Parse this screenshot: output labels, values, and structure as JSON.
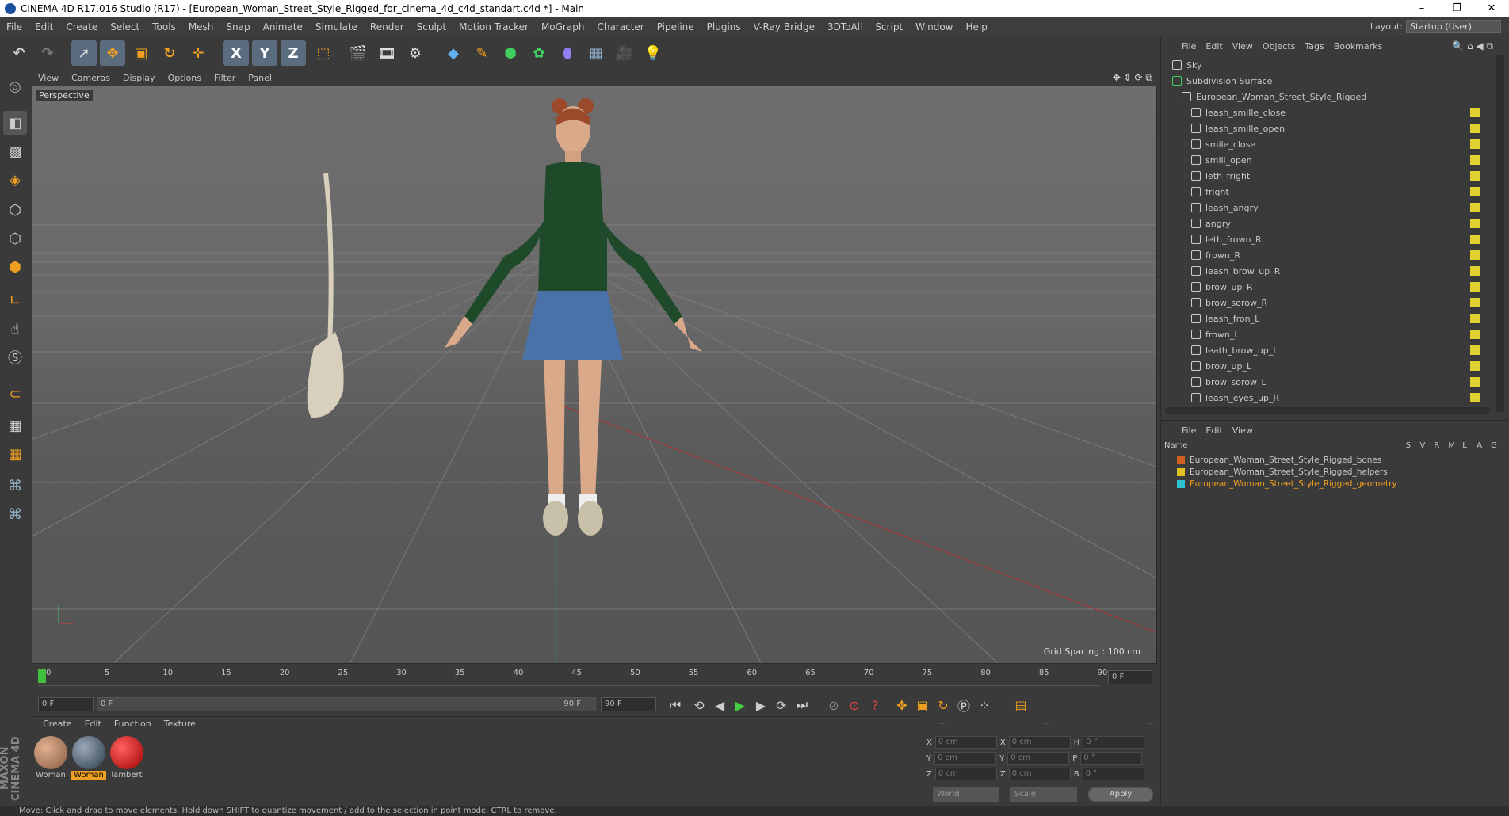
{
  "window": {
    "title": "CINEMA 4D R17.016 Studio (R17) - [European_Woman_Street_Style_Rigged_for_cinema_4d_c4d_standart.c4d *] - Main",
    "controls": [
      "–",
      "❐",
      "✕"
    ]
  },
  "menubar": {
    "items": [
      "File",
      "Edit",
      "Create",
      "Select",
      "Tools",
      "Mesh",
      "Snap",
      "Animate",
      "Simulate",
      "Render",
      "Sculpt",
      "Motion Tracker",
      "MoGraph",
      "Character",
      "Pipeline",
      "Plugins",
      "V-Ray Bridge",
      "3DToAll",
      "Script",
      "Window",
      "Help"
    ],
    "layout_label": "Layout:",
    "layout_value": "Startup (User)"
  },
  "toolbar": {
    "axis_x": "X",
    "axis_y": "Y",
    "axis_z": "Z"
  },
  "viewport": {
    "menu": [
      "View",
      "Cameras",
      "Display",
      "Options",
      "Filter",
      "Panel"
    ],
    "label": "Perspective",
    "grid_spacing": "Grid Spacing : 100 cm"
  },
  "timeline": {
    "ticks": [
      "0",
      "5",
      "10",
      "15",
      "20",
      "25",
      "30",
      "35",
      "40",
      "45",
      "50",
      "55",
      "60",
      "65",
      "70",
      "75",
      "80",
      "85",
      "90"
    ],
    "frame_readout": "0 F",
    "start_field": "0 F",
    "range_start": "0 F",
    "range_end": "90 F",
    "end_field": "90 F"
  },
  "materials": {
    "menu": [
      "Create",
      "Edit",
      "Function",
      "Texture"
    ],
    "items": [
      {
        "name": "Woman",
        "color": "#b07a5a",
        "selected": false
      },
      {
        "name": "Woman",
        "color": "#4a5a6a",
        "selected": true
      },
      {
        "name": "lambert",
        "color": "#e01010",
        "selected": false
      }
    ]
  },
  "coordinates": {
    "header": [
      "--",
      "--",
      "--"
    ],
    "rows": [
      {
        "a": "X",
        "av": "0 cm",
        "b": "X",
        "bv": "0 cm",
        "c": "H",
        "cv": "0 °"
      },
      {
        "a": "Y",
        "av": "0 cm",
        "b": "Y",
        "bv": "0 cm",
        "c": "P",
        "cv": "0 °"
      },
      {
        "a": "Z",
        "av": "0 cm",
        "b": "Z",
        "bv": "0 cm",
        "c": "B",
        "cv": "0 °"
      }
    ],
    "world": "World",
    "scale": "Scale",
    "apply": "Apply"
  },
  "objects": {
    "menu": [
      "File",
      "Edit",
      "View",
      "Objects",
      "Tags",
      "Bookmarks"
    ],
    "items": [
      {
        "name": "Sky",
        "indent": 0
      },
      {
        "name": "Subdivision Surface",
        "indent": 0
      },
      {
        "name": "European_Woman_Street_Style_Rigged",
        "indent": 1
      },
      {
        "name": "leash_smille_close",
        "indent": 2
      },
      {
        "name": "leash_smille_open",
        "indent": 2
      },
      {
        "name": "smile_close",
        "indent": 2
      },
      {
        "name": "smill_open",
        "indent": 2
      },
      {
        "name": "leth_fright",
        "indent": 2
      },
      {
        "name": "fright",
        "indent": 2
      },
      {
        "name": "leash_angry",
        "indent": 2
      },
      {
        "name": "angry",
        "indent": 2
      },
      {
        "name": "leth_frown_R",
        "indent": 2
      },
      {
        "name": "frown_R",
        "indent": 2
      },
      {
        "name": "leash_brow_up_R",
        "indent": 2
      },
      {
        "name": "brow_up_R",
        "indent": 2
      },
      {
        "name": "brow_sorow_R",
        "indent": 2
      },
      {
        "name": "leash_fron_L",
        "indent": 2
      },
      {
        "name": "frown_L",
        "indent": 2
      },
      {
        "name": "leath_brow_up_L",
        "indent": 2
      },
      {
        "name": "brow_up_L",
        "indent": 2
      },
      {
        "name": "brow_sorow_L",
        "indent": 2
      },
      {
        "name": "leash_eyes_up_R",
        "indent": 2
      }
    ]
  },
  "layers": {
    "menu": [
      "File",
      "Edit",
      "View"
    ],
    "columns": [
      "Name",
      "S",
      "V",
      "R",
      "M",
      "L",
      "A",
      "G"
    ],
    "items": [
      {
        "name": "European_Woman_Street_Style_Rigged_bones",
        "color": "#d06020",
        "highlight": false
      },
      {
        "name": "European_Woman_Street_Style_Rigged_helpers",
        "color": "#e0c020",
        "highlight": false
      },
      {
        "name": "European_Woman_Street_Style_Rigged_geometry",
        "color": "#30c0d0",
        "highlight": true
      }
    ]
  },
  "status": {
    "text": "Move: Click and drag to move elements. Hold down SHIFT to quantize movement / add to the selection in point mode, CTRL to remove."
  }
}
